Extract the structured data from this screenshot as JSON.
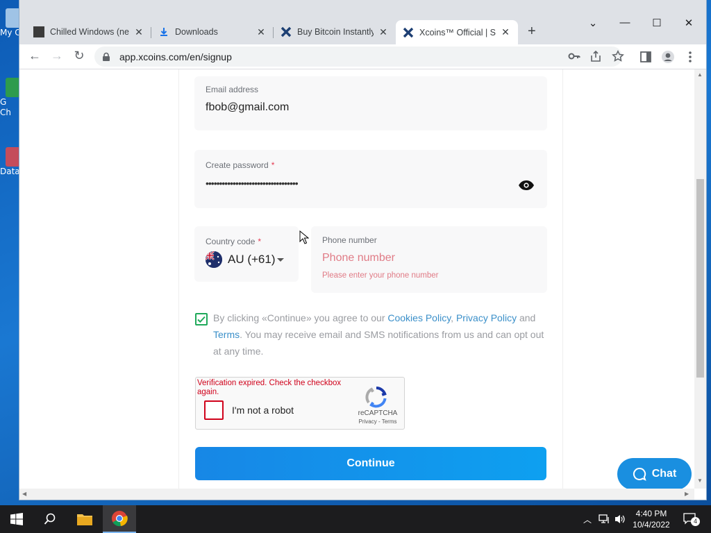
{
  "desktop": {
    "icons": [
      {
        "label": "My C"
      },
      {
        "label": "G\nCh"
      },
      {
        "label": "Data"
      }
    ]
  },
  "browser": {
    "tabs": [
      {
        "title": "Chilled Windows (new",
        "active": false
      },
      {
        "title": "Downloads",
        "active": false
      },
      {
        "title": "Buy Bitcoin Instantly",
        "active": false
      },
      {
        "title": "Xcoins™ Official | Sig",
        "active": true
      }
    ],
    "new_tab": "+",
    "address": "app.xcoins.com/en/signup"
  },
  "form": {
    "email": {
      "label": "Email address",
      "value": "fbob@gmail.com"
    },
    "password": {
      "label": "Create password",
      "required_mark": "*",
      "value": "••••••••••••••••••••••••••••••••••"
    },
    "country": {
      "label": "Country code",
      "required_mark": "*",
      "value": "AU (+61)"
    },
    "phone": {
      "label": "Phone number",
      "placeholder": "Phone number",
      "error": "Please enter your phone number"
    },
    "consent": {
      "checked": true,
      "text_1": "By clicking «Continue» you agree to our ",
      "link_cookies": "Cookies Policy",
      "sep": ", ",
      "link_privacy": "Privacy Policy",
      "and": " and ",
      "link_terms": "Terms",
      "text_2": ". You may receive email and SMS notifications from us and can opt out at any time."
    },
    "recaptcha": {
      "error": "Verification expired. Check the checkbox again.",
      "label": "I'm not a robot",
      "brand": "reCAPTCHA",
      "links": "Privacy - Terms"
    },
    "continue_label": "Continue"
  },
  "chat_label": "Chat",
  "taskbar": {
    "time": "4:40 PM",
    "date": "10/4/2022",
    "notification_count": "4"
  },
  "colors": {
    "accent": "#1787e6",
    "error": "#d0021b",
    "link": "#3a8fc9",
    "checkbox": "#1fa95a"
  }
}
